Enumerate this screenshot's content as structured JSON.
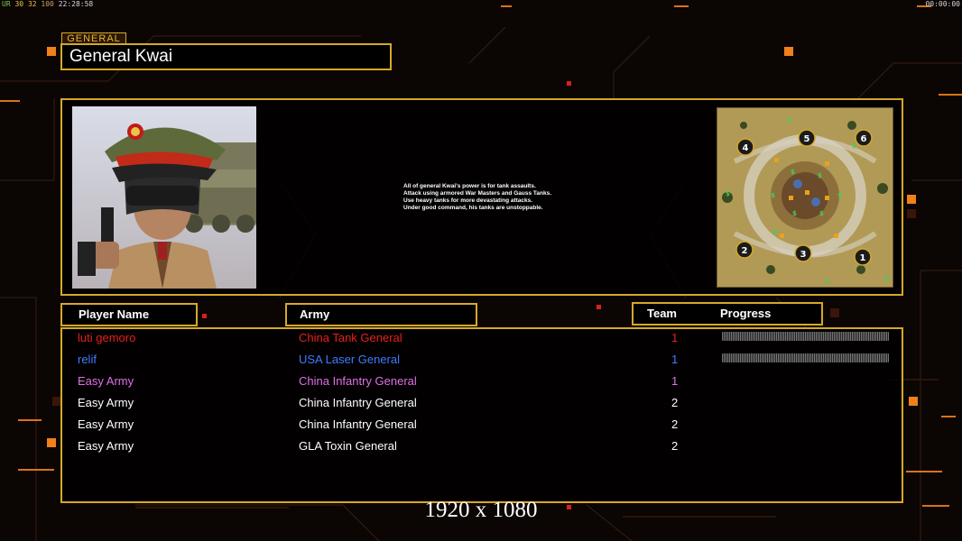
{
  "hud": {
    "fps_parts": [
      "UR",
      "30",
      "32",
      "100",
      "22:28:58"
    ],
    "clock": "00:00:00"
  },
  "general": {
    "label": "GENERAL",
    "name": "General Kwai",
    "description": [
      "All of general Kwai's power is for tank assaults.",
      "Attack using armored War Masters and Gauss Tanks.",
      "Use heavy tanks for more devastating attacks.",
      "Under good command, his tanks are unstoppable."
    ]
  },
  "minimap": {
    "start_positions": [
      "1",
      "2",
      "3",
      "4",
      "5",
      "6"
    ]
  },
  "columns": {
    "player_name": "Player Name",
    "army": "Army",
    "team": "Team",
    "progress": "Progress"
  },
  "players": [
    {
      "name": "luti gemoro",
      "army": "China Tank General",
      "team": "1",
      "color": "#e8201c",
      "progress": 1.0,
      "show_progress": true
    },
    {
      "name": "relif",
      "army": "USA Laser General",
      "team": "1",
      "color": "#3d7dff",
      "progress": 1.0,
      "show_progress": true
    },
    {
      "name": "Easy Army",
      "army": "China Infantry General",
      "team": "1",
      "color": "#e070e8",
      "progress": 0,
      "show_progress": false
    },
    {
      "name": "Easy Army",
      "army": "China Infantry General",
      "team": "2",
      "color": "#ffffff",
      "progress": 0,
      "show_progress": false
    },
    {
      "name": "Easy Army",
      "army": "China Infantry General",
      "team": "2",
      "color": "#ffffff",
      "progress": 0,
      "show_progress": false
    },
    {
      "name": "Easy Army",
      "army": "GLA Toxin General",
      "team": "2",
      "color": "#ffffff",
      "progress": 0,
      "show_progress": false
    }
  ],
  "resolution_text": "1920 x 1080",
  "colors": {
    "accent_gold": "#d6a829",
    "accent_orange": "#f0801a"
  }
}
